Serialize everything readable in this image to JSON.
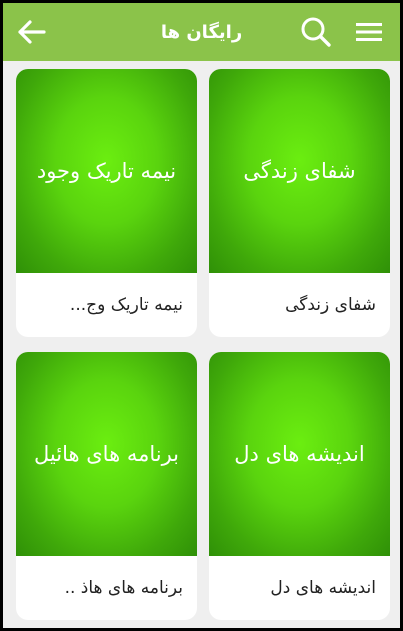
{
  "header": {
    "title": "رایگان ها",
    "back_icon": "back-arrow-icon",
    "search_icon": "search-icon",
    "menu_icon": "menu-icon",
    "bar_color": "#8bc34a"
  },
  "cards": [
    {
      "image_text": "شفای زندگی",
      "caption": "شفای زندگی"
    },
    {
      "image_text": "نیمه تاریک وجود",
      "caption": "نیمه تاریک وج..."
    },
    {
      "image_text": "اندیشه های دل",
      "caption": "اندیشه های دل"
    },
    {
      "image_text": "برنامه های هائیل",
      "caption": "برنامه های هاذ .."
    }
  ]
}
